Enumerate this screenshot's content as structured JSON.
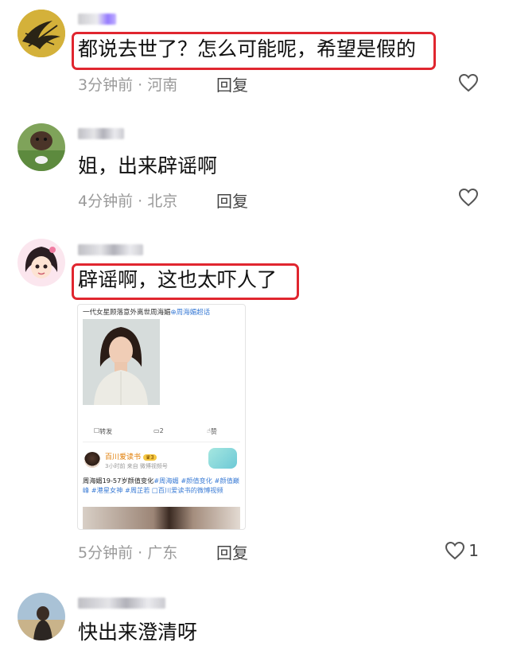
{
  "comments": [
    {
      "text": "都说去世了？怎么可能呢，希望是假的",
      "location": "3分钟前 · 河南",
      "reply_label": "回复",
      "likes": ""
    },
    {
      "text": "姐，出来辟谣啊",
      "location": "4分钟前 · 北京",
      "reply_label": "回复",
      "likes": ""
    },
    {
      "text": "辟谣啊，这也太吓人了",
      "location": "5分钟前 · 广东",
      "reply_label": "回复",
      "likes": "1"
    },
    {
      "text": "快出来澄清呀",
      "location": "",
      "reply_label": "",
      "likes": ""
    }
  ],
  "embed": {
    "title": "一代女星顾落意外离世周海媚",
    "title_tag": "⊕周海媚超话",
    "repost": "转发",
    "comment_count": "2",
    "like_label": "赞",
    "account": "百川爱读书",
    "account_badge": "♛3",
    "time": "3小时前  来自 微博视频号",
    "body_prefix": "周海媚19-57岁颜值变化",
    "body_tags": "#周海媚 #颜值变化 #颜值巅峰 #港星女神 #周芷若",
    "body_suffix": "□百川爱读书的微博视频"
  },
  "colors": {
    "highlight_border": "#e0262f",
    "meta_text": "#9a9a9a",
    "topic_blue": "#3a7bd5",
    "account_orange": "#e07b00"
  },
  "icons": {
    "like": "heart-outline-icon"
  }
}
